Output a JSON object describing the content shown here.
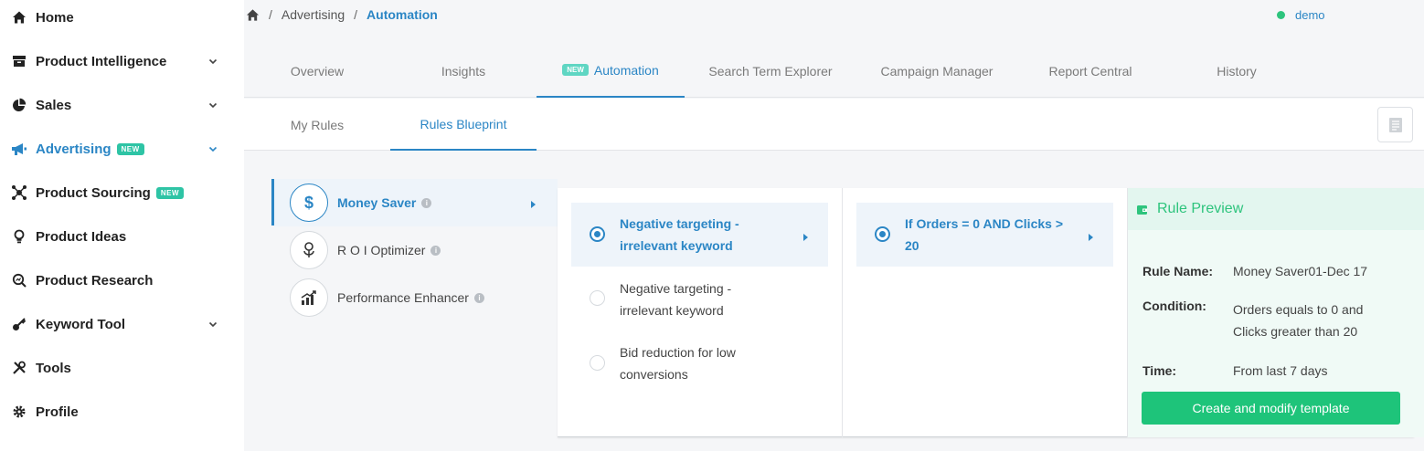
{
  "sidebar": {
    "items": [
      {
        "label": "Home",
        "icon": "home-icon"
      },
      {
        "label": "Product Intelligence",
        "icon": "archive-icon"
      },
      {
        "label": "Sales",
        "icon": "pie-chart-icon"
      },
      {
        "label": "Advertising",
        "icon": "megaphone-icon",
        "badge": "NEW"
      },
      {
        "label": "Product Sourcing",
        "icon": "network-icon",
        "badge": "NEW"
      },
      {
        "label": "Product Ideas",
        "icon": "lightbulb-icon"
      },
      {
        "label": "Product Research",
        "icon": "search-chart-icon"
      },
      {
        "label": "Keyword Tool",
        "icon": "key-icon"
      },
      {
        "label": "Tools",
        "icon": "tools-icon"
      },
      {
        "label": "Profile",
        "icon": "gear-icon"
      }
    ]
  },
  "breadcrumb": {
    "items": [
      "Advertising",
      "Automation"
    ]
  },
  "user": {
    "name": "demo",
    "status_color": "#2ec47d"
  },
  "tabs": [
    {
      "label": "Overview"
    },
    {
      "label": "Insights"
    },
    {
      "label": "Automation",
      "badge": "NEW"
    },
    {
      "label": "Search Term Explorer"
    },
    {
      "label": "Campaign Manager"
    },
    {
      "label": "Report Central"
    },
    {
      "label": "History"
    }
  ],
  "subtabs": [
    {
      "label": "My Rules"
    },
    {
      "label": "Rules Blueprint"
    }
  ],
  "categories": [
    {
      "label": "Money Saver",
      "icon": "dollar-icon"
    },
    {
      "label": "R O I Optimizer",
      "icon": "plant-money-icon"
    },
    {
      "label": "Performance Enhancer",
      "icon": "growth-chart-icon"
    }
  ],
  "rule_types": [
    {
      "label": "Negative targeting - irrelevant keyword"
    },
    {
      "label": "Negative targeting - irrelevant keyword"
    },
    {
      "label": "Bid reduction for low conversions"
    }
  ],
  "conditions": [
    {
      "label": "If Orders = 0 AND Clicks > 20"
    }
  ],
  "preview": {
    "title": "Rule Preview",
    "rule_name_label": "Rule Name:",
    "rule_name": "Money Saver01-Dec 17",
    "condition_label": "Condition:",
    "condition": "Orders equals to 0 and Clicks greater than 20",
    "time_label": "Time:",
    "time": "From last 7 days",
    "button": "Create and modify template"
  },
  "colors": {
    "accent": "#2b86c5",
    "success": "#1ec47a",
    "badge": "#2ec4a5"
  }
}
